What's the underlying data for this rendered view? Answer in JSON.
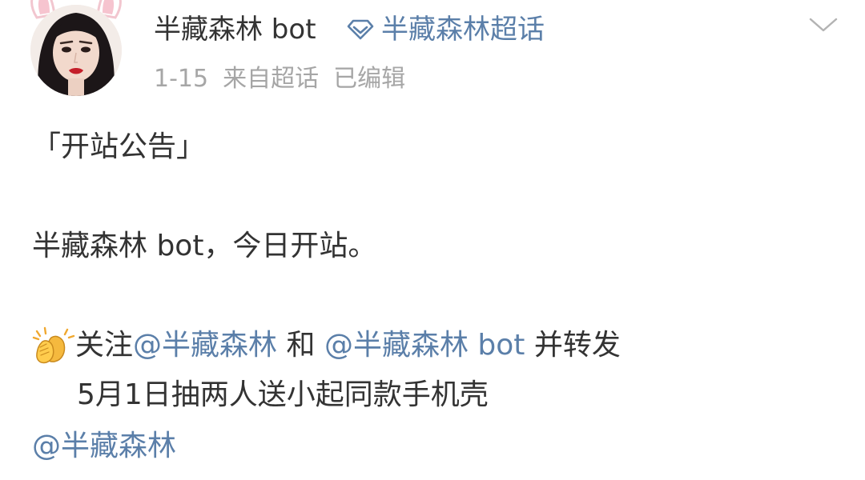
{
  "header": {
    "username": "半藏森林 bot",
    "supertopic_label": "半藏森林超话",
    "date": "1-15",
    "source": "来自超话",
    "edited": "已编辑",
    "accent_color": "#5b7fa9"
  },
  "icons": {
    "supertopic": "diamond-icon",
    "menu": "chevron-down-icon",
    "emoji": "clapping-hands-icon"
  },
  "body": {
    "announcement_title": "「开站公告」",
    "intro_line": "半藏森林 bot，今日开站。",
    "follow_prefix": "关注",
    "mention_1": "@半藏森林",
    "connector": " 和",
    "mention_2": "@半藏森林 bot",
    "repost_text": " 并转发",
    "giveaway_line": "5月1日抽两人送小起同款手机壳",
    "mention_3": "@半藏森林"
  }
}
